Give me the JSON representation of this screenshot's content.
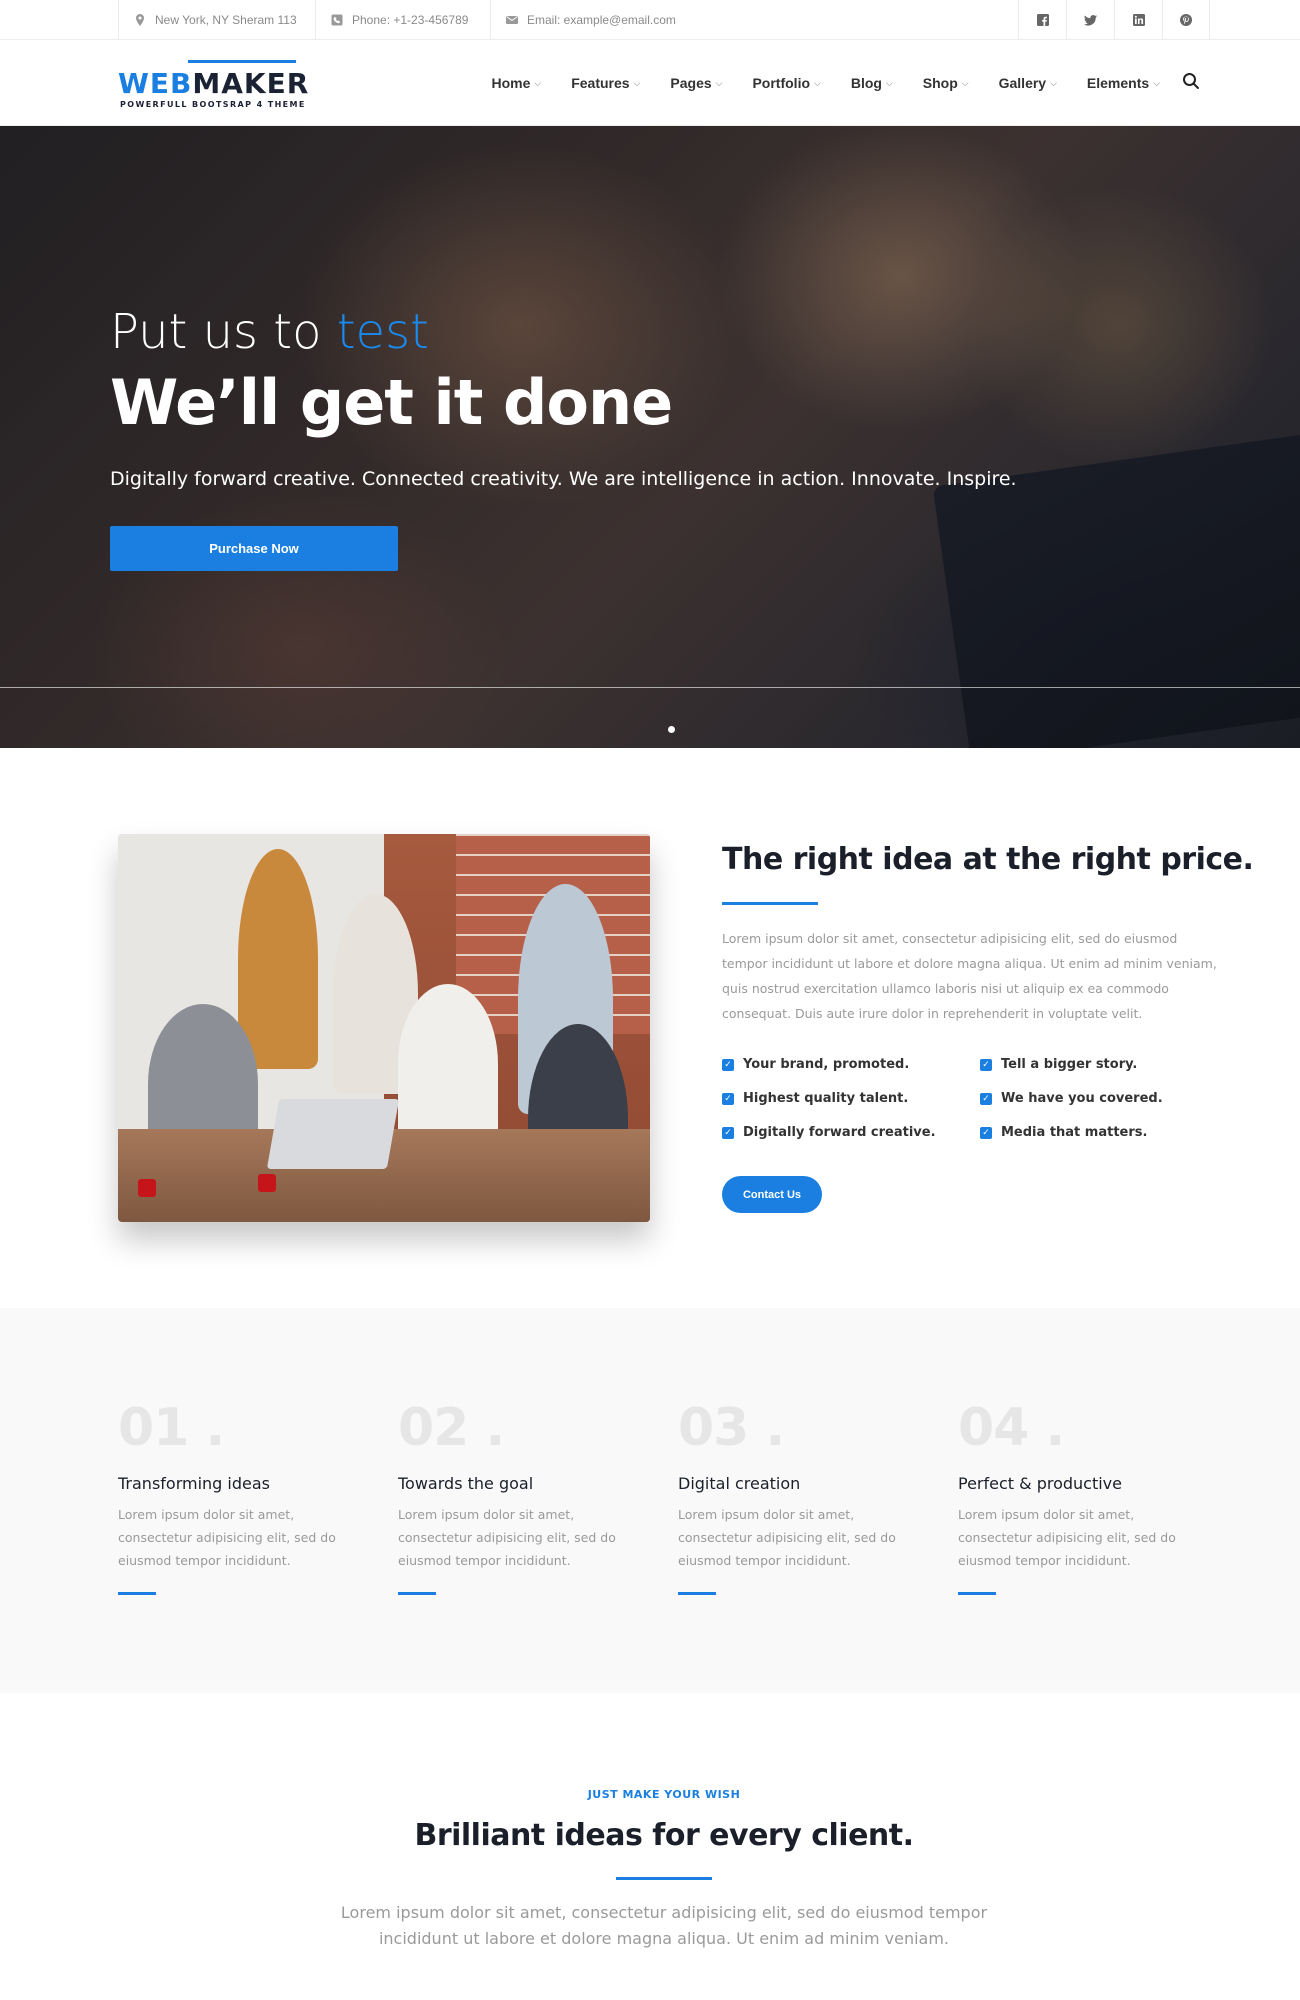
{
  "topbar": {
    "address": "New York, NY Sheram 113",
    "phone": "Phone: +1-23-456789",
    "email": "Email: example@email.com",
    "socials": [
      "facebook-icon",
      "twitter-icon",
      "linkedin-icon",
      "pinterest-icon"
    ]
  },
  "logo": {
    "part1": "WEB",
    "part2": "MAKER",
    "tagline": "POWERFULL BOOTSRAP 4 THEME"
  },
  "nav": {
    "items": [
      "Home",
      "Features",
      "Pages",
      "Portfolio",
      "Blog",
      "Shop",
      "Gallery",
      "Elements"
    ]
  },
  "hero": {
    "pre_text": "Put us to ",
    "pre_accent": "test",
    "title": "We’ll get it done",
    "subtitle": "Digitally forward creative. Connected creativity. We are intelligence in action. Innovate. Inspire.",
    "button": "Purchase Now"
  },
  "about": {
    "title": "The right idea at the right price.",
    "text": "Lorem ipsum dolor sit amet, consectetur adipisicing elit, sed do eiusmod tempor incididunt ut labore et dolore magna aliqua. Ut enim ad minim veniam, quis nostrud exercitation ullamco laboris nisi ut aliquip ex ea commodo consequat. Duis aute irure dolor in reprehenderit in voluptate velit.",
    "checks": [
      "Your brand, promoted.",
      "Tell a bigger story.",
      "Highest quality talent.",
      "We have you covered.",
      "Digitally forward creative.",
      "Media that matters."
    ],
    "button": "Contact Us"
  },
  "features": [
    {
      "num": "01 .",
      "title": "Transforming ideas",
      "text": "Lorem ipsum dolor sit amet, consectetur adipisicing elit, sed do eiusmod tempor incididunt."
    },
    {
      "num": "02 .",
      "title": "Towards the goal",
      "text": "Lorem ipsum dolor sit amet, consectetur adipisicing elit, sed do eiusmod tempor incididunt."
    },
    {
      "num": "03 .",
      "title": "Digital creation",
      "text": "Lorem ipsum dolor sit amet, consectetur adipisicing elit, sed do eiusmod tempor incididunt."
    },
    {
      "num": "04 .",
      "title": "Perfect & productive",
      "text": "Lorem ipsum dolor sit amet, consectetur adipisicing elit, sed do eiusmod tempor incididunt."
    }
  ],
  "cta": {
    "kicker": "JUST MAKE YOUR WISH",
    "title": "Brilliant ideas for every client.",
    "text": "Lorem ipsum dolor sit amet, consectetur adipisicing elit, sed do eiusmod tempor incididunt ut labore et dolore magna aliqua. Ut enim ad minim veniam."
  },
  "colors": {
    "accent": "#1a7fe0",
    "dark": "#1a1f2a",
    "muted": "#9a9a9a"
  }
}
